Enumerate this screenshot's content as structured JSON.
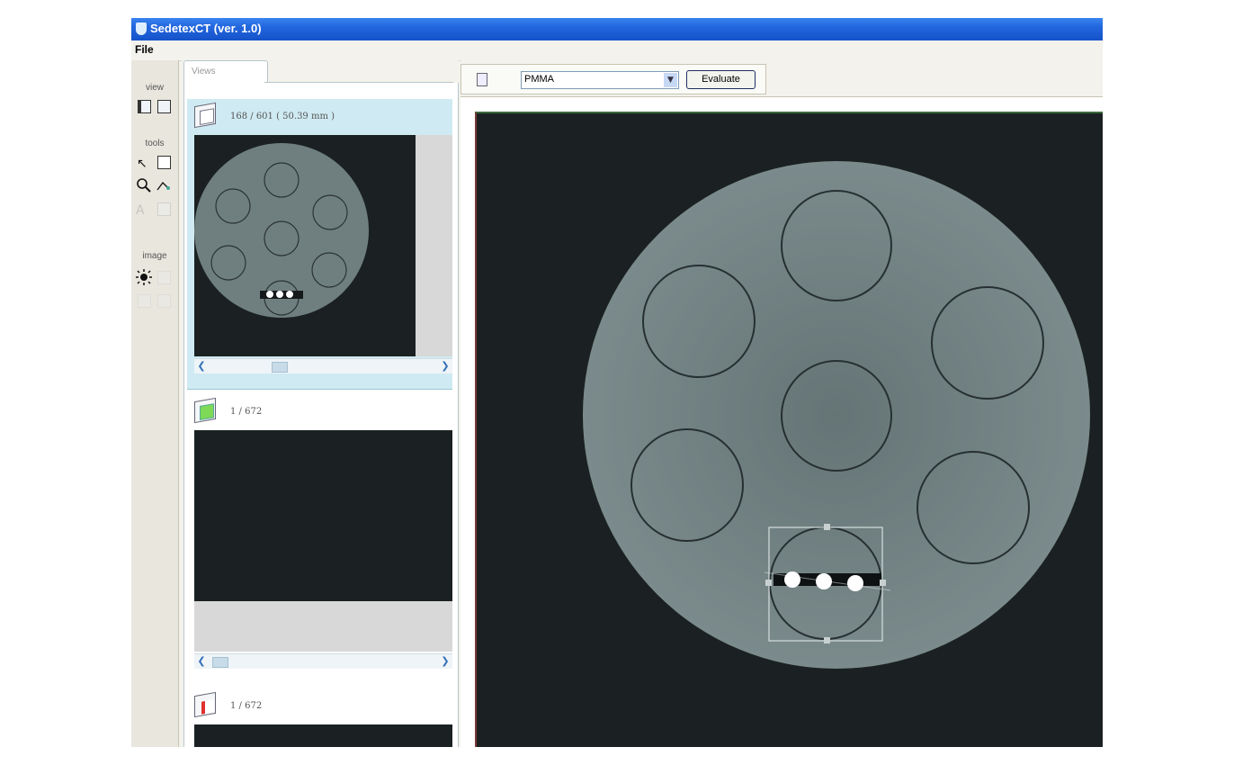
{
  "window": {
    "title": "SedetexCT (ver. 1.0)"
  },
  "menu": {
    "file": "File"
  },
  "toolbox": {
    "view_label": "view",
    "tools_label": "tools",
    "image_label": "image",
    "icons": [
      "layout-icon",
      "square-icon",
      "pointer-icon",
      "select-rect-icon",
      "zoom-icon",
      "measure-icon",
      "text-icon",
      "brightness-icon"
    ]
  },
  "views": {
    "tab_label": "Views",
    "panels": [
      {
        "slice": "168 / 601 ( 50.39 mm )",
        "color": "#ffffff"
      },
      {
        "slice": "1 / 672",
        "color": "#7ed957"
      },
      {
        "slice": "1 / 672",
        "color": "#e03030"
      }
    ]
  },
  "toolbar": {
    "material": "PMMA",
    "evaluate_label": "Evaluate"
  },
  "colors": {
    "title_bar": "#2266dd",
    "scan_background": "#1b2122",
    "phantom": "#6f7f80"
  }
}
